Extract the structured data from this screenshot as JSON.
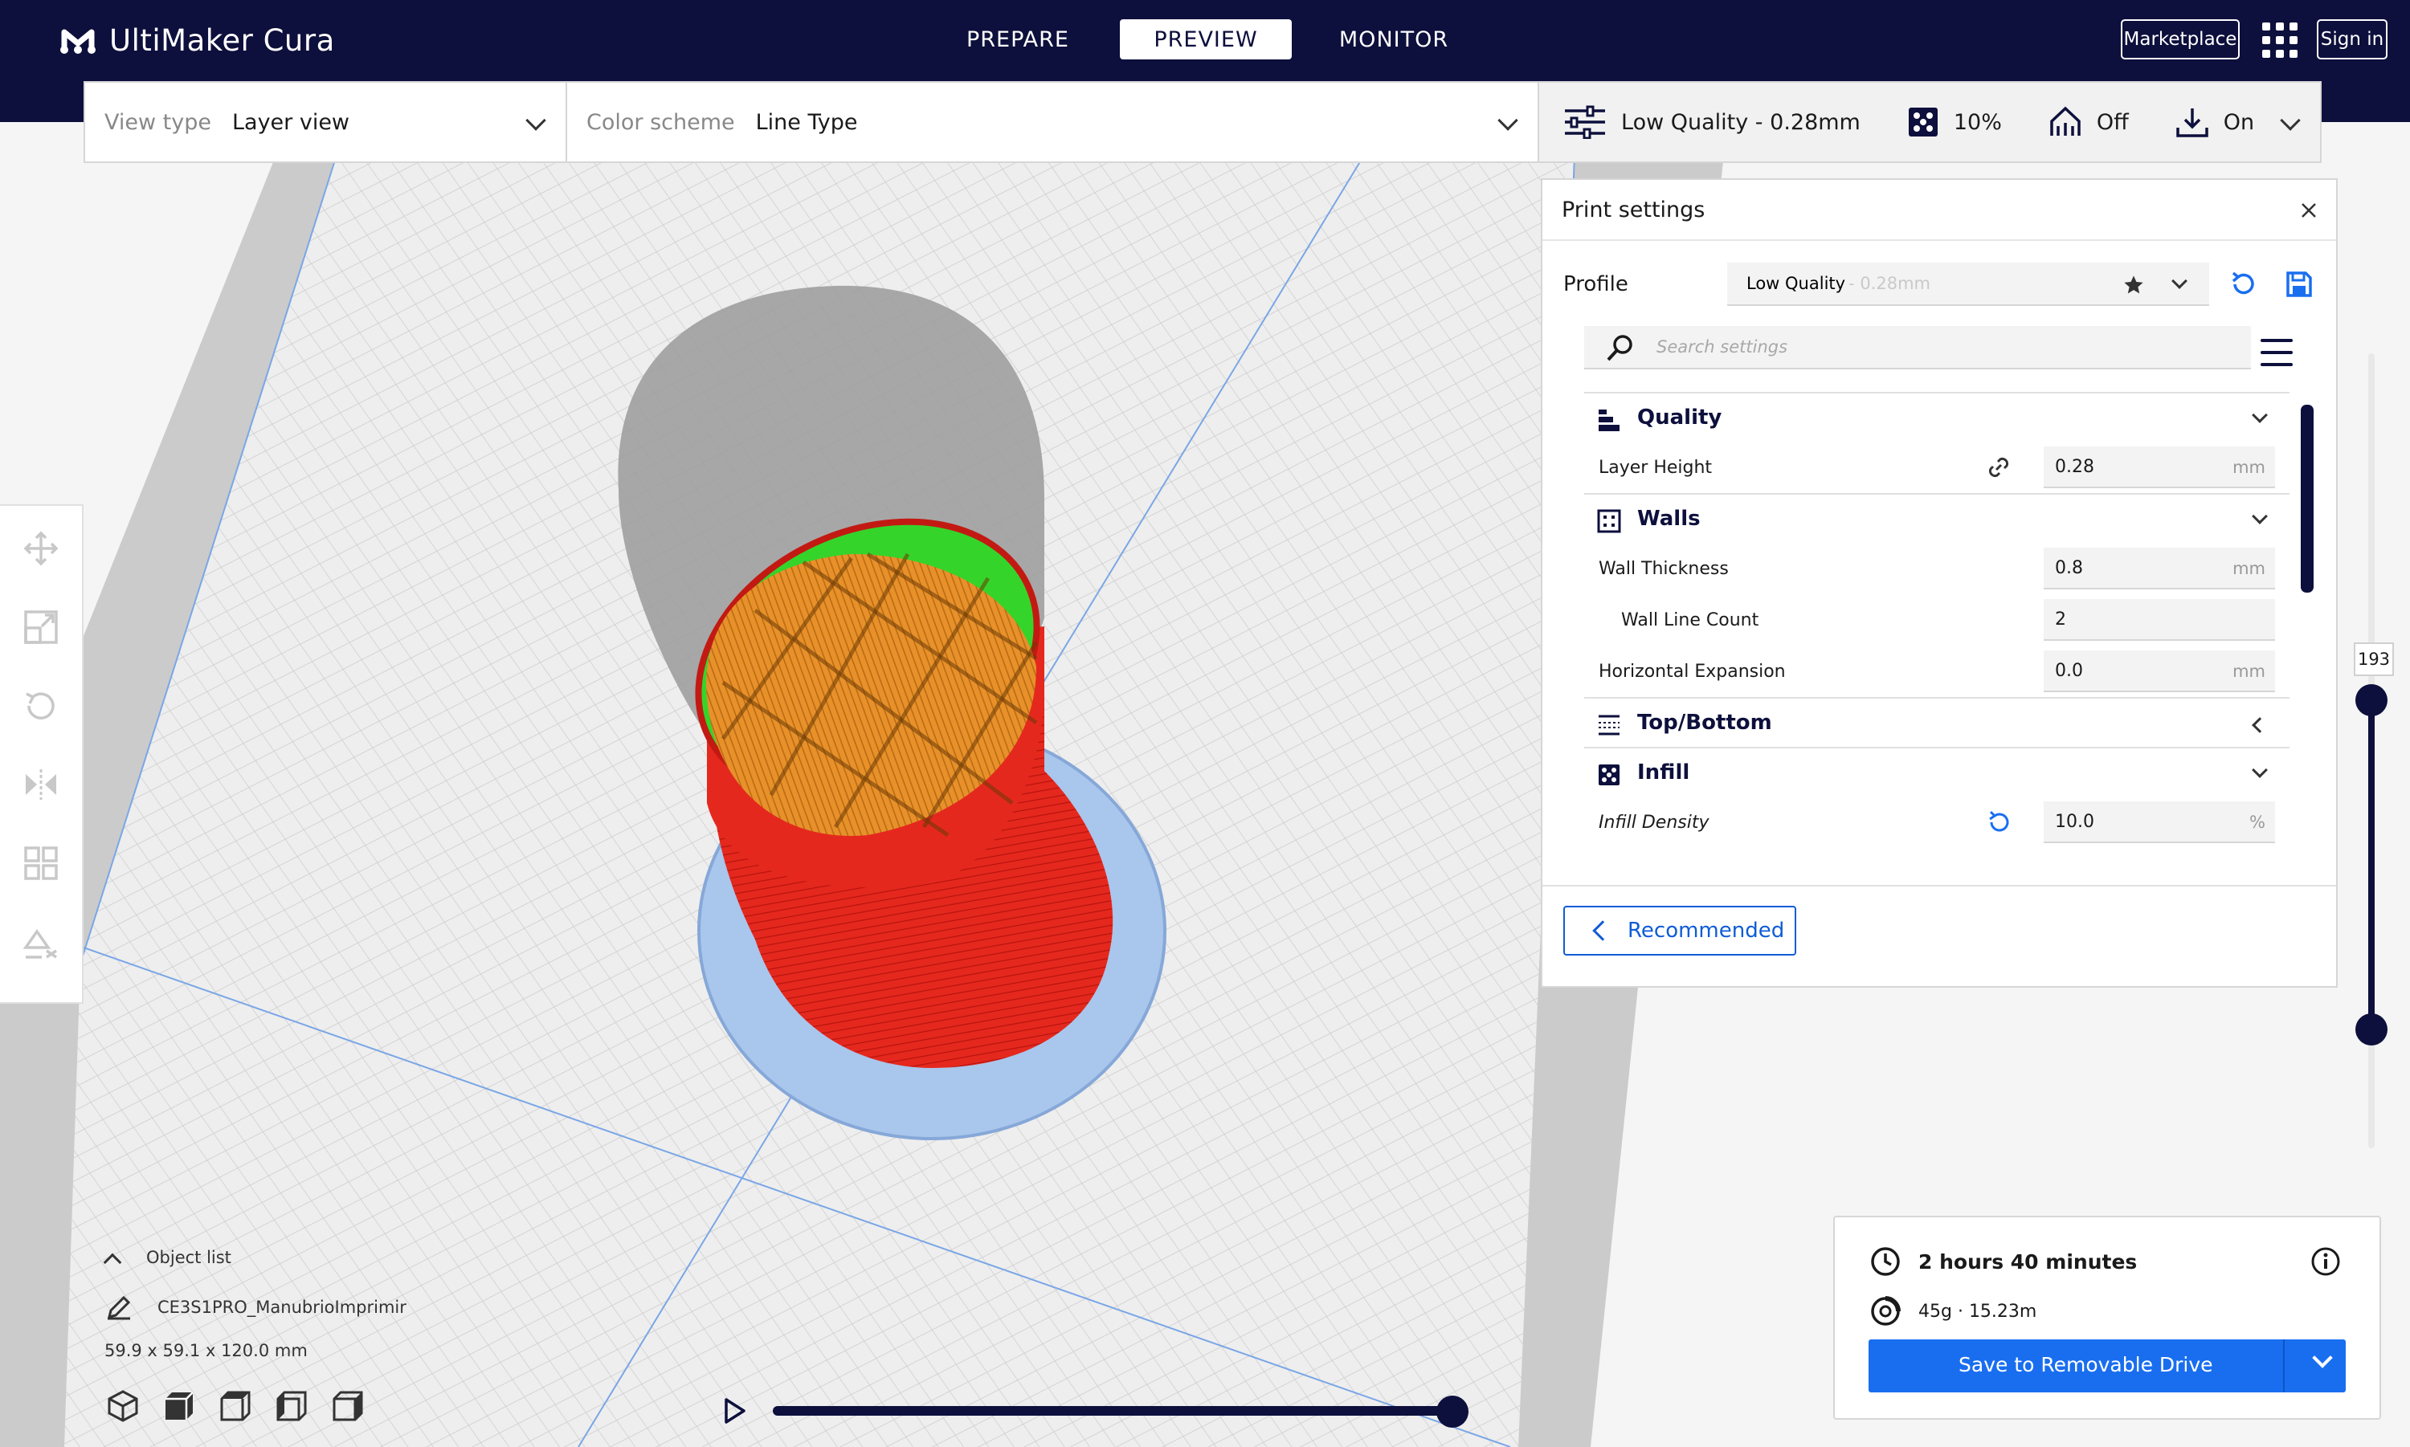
{
  "app": {
    "title": "UltiMaker Cura"
  },
  "stages": [
    {
      "label": "PREPARE",
      "active": false
    },
    {
      "label": "PREVIEW",
      "active": true
    },
    {
      "label": "MONITOR",
      "active": false
    }
  ],
  "header": {
    "marketplace_label": "Marketplace",
    "signin_label": "Sign in"
  },
  "toolbar": {
    "view_type_label": "View type",
    "view_type_value": "Layer view",
    "color_scheme_label": "Color scheme",
    "color_scheme_value": "Line Type",
    "quality_value": "Low Quality - 0.28mm",
    "infill_value": "10%",
    "support_value": "Off",
    "adhesion_value": "On"
  },
  "print_settings": {
    "title": "Print settings",
    "profile_label": "Profile",
    "profile_name": "Low Quality",
    "profile_suffix": " - 0.28mm",
    "search_placeholder": "Search settings",
    "categories": [
      {
        "name": "Quality"
      },
      {
        "name": "Walls"
      },
      {
        "name": "Top/Bottom"
      },
      {
        "name": "Infill"
      }
    ],
    "settings": {
      "layer_height": {
        "label": "Layer Height",
        "value": "0.28",
        "unit": "mm"
      },
      "wall_thickness": {
        "label": "Wall Thickness",
        "value": "0.8",
        "unit": "mm"
      },
      "wall_line_count": {
        "label": "Wall Line Count",
        "value": "2"
      },
      "horizontal_expansion": {
        "label": "Horizontal Expansion",
        "value": "0.0",
        "unit": "mm"
      },
      "infill_density": {
        "label": "Infill Density",
        "value": "10.0",
        "unit": "%"
      }
    },
    "recommended_label": "Recommended"
  },
  "layer_slider": {
    "current_layer": "193"
  },
  "object_list": {
    "header": "Object list",
    "object_name": "CE3S1PRO_ManubrioImprimir",
    "dimensions": "59.9 x 59.1 x 120.0 mm"
  },
  "output": {
    "print_time": "2 hours 40 minutes",
    "material": "45g · 15.23m",
    "save_label": "Save to Removable Drive"
  },
  "colors": {
    "header_bg": "#0d0f3c",
    "accent_blue": "#196ef0",
    "wall_red": "#e5281e",
    "infill_orange": "#e8912a",
    "skin_green": "#35d42a",
    "skirt_blue": "#a9c6ec"
  }
}
